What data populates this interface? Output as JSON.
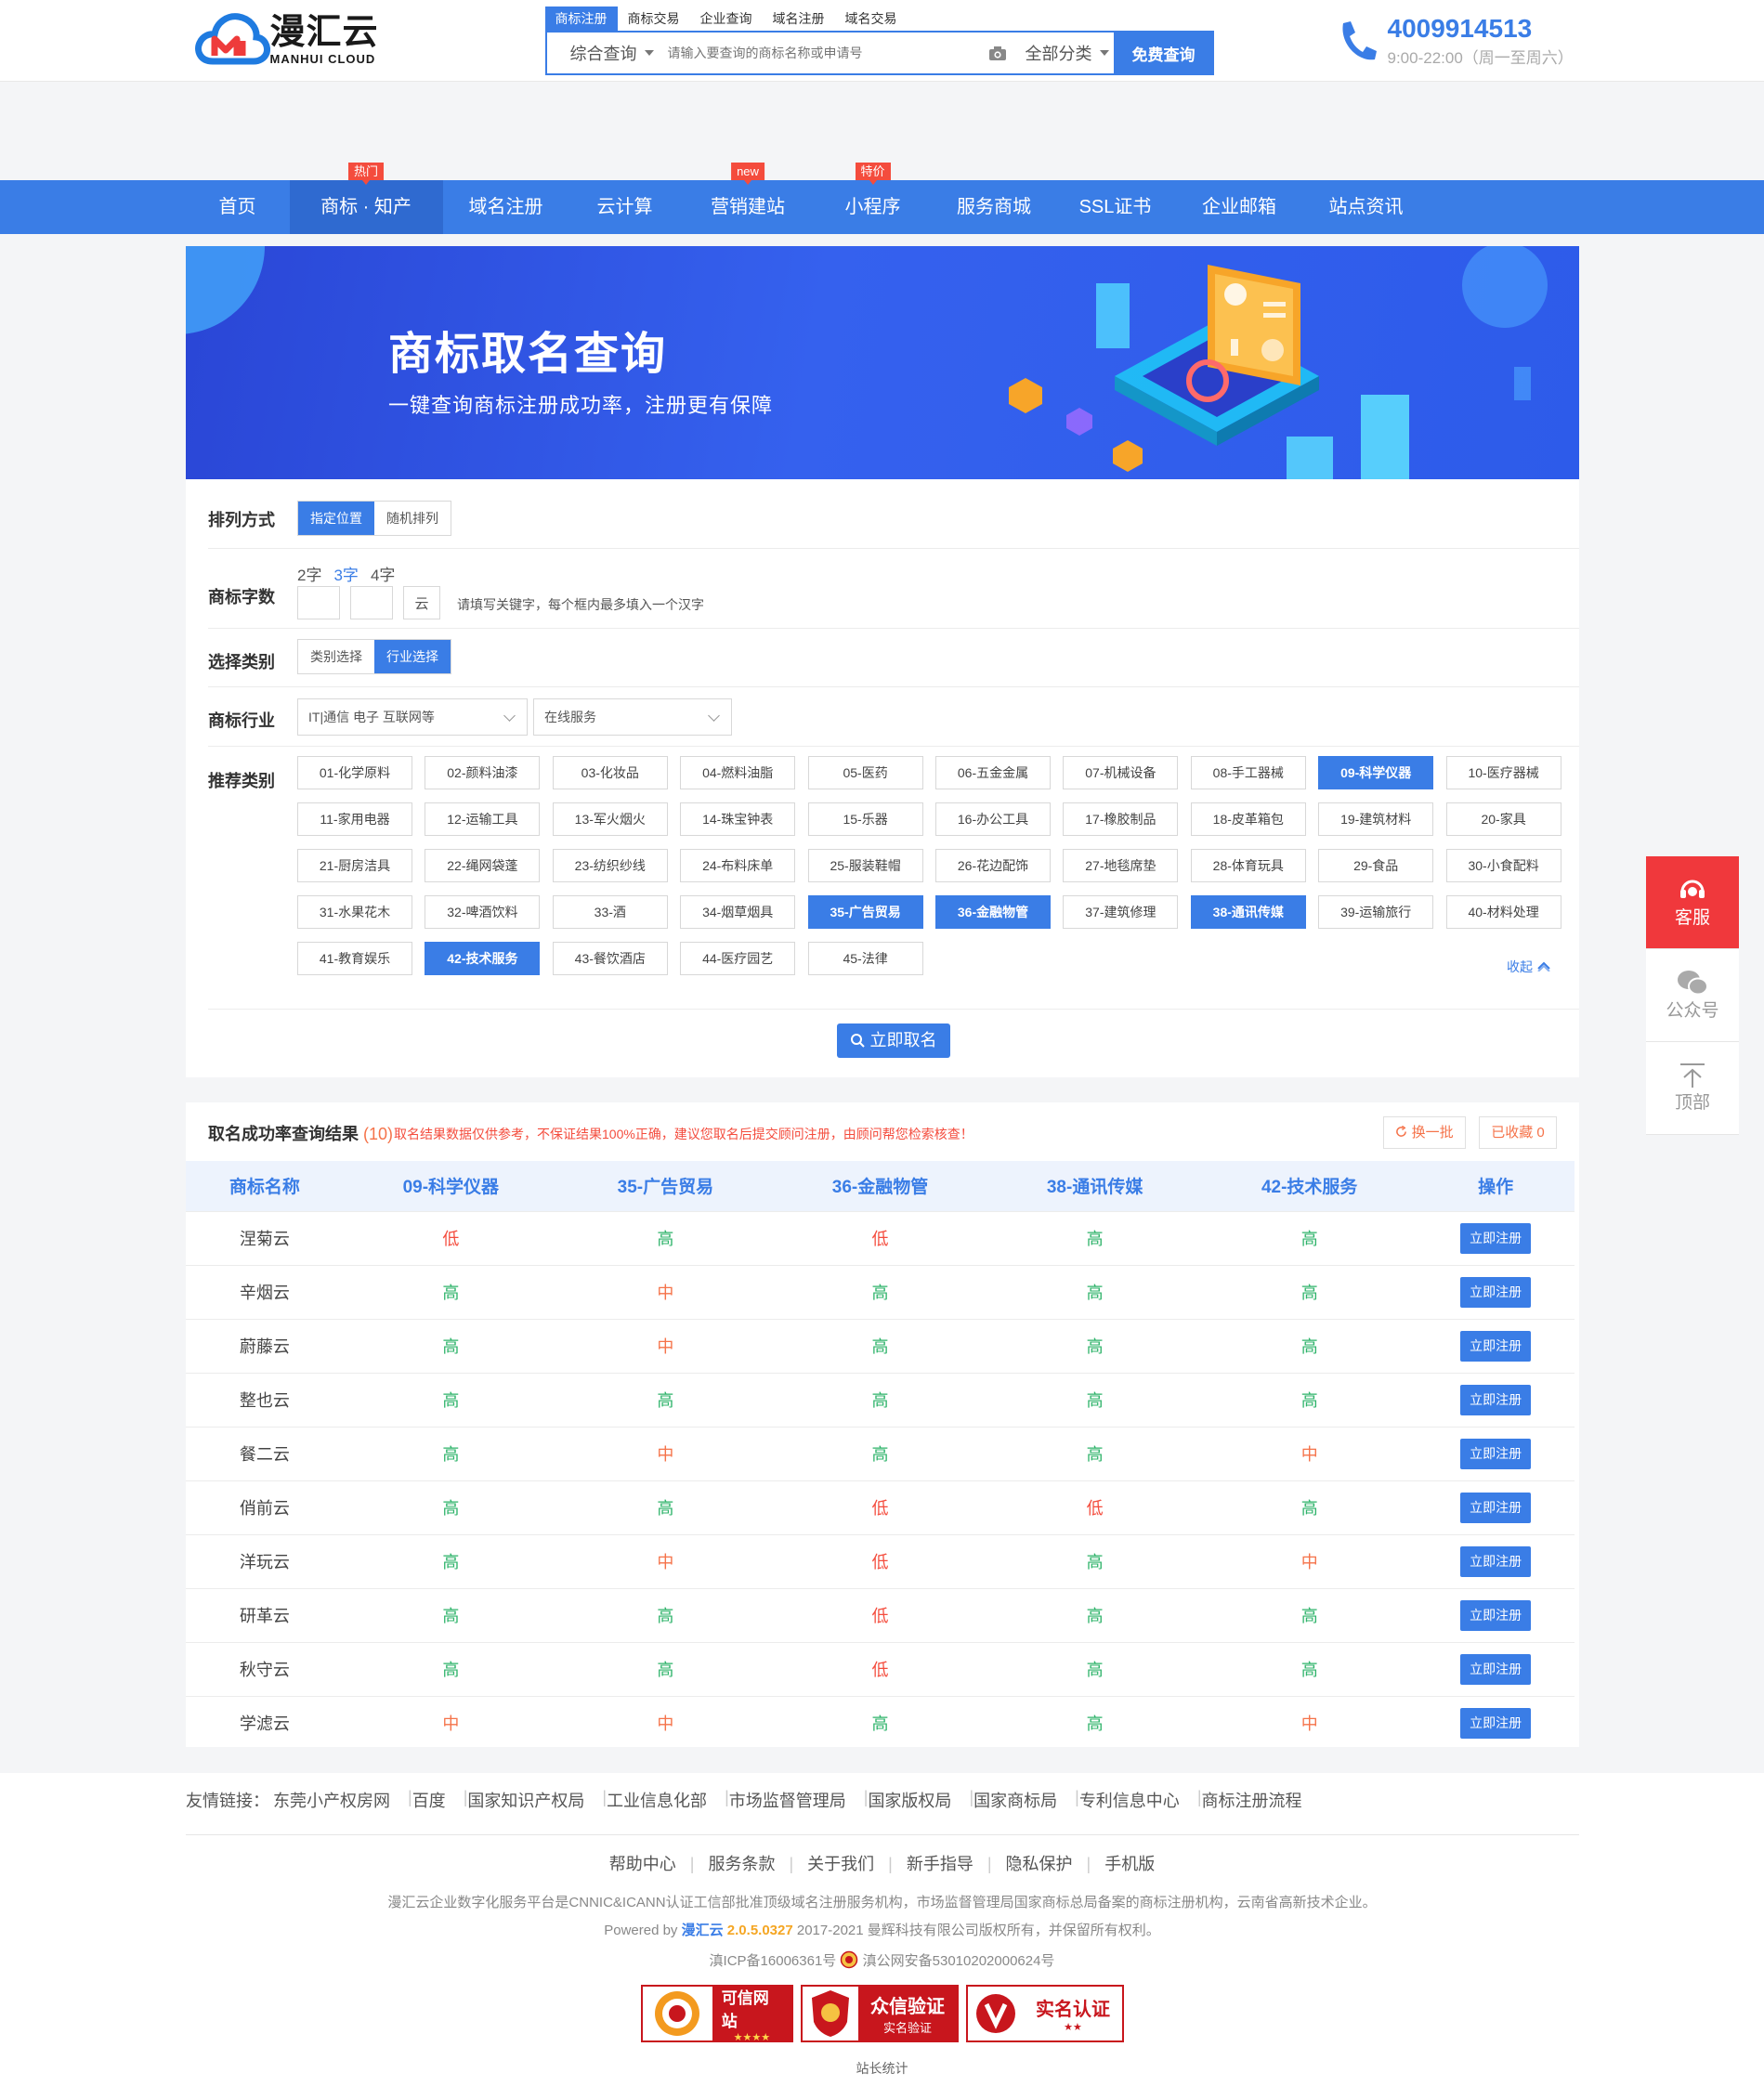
{
  "brand": {
    "name_cn": "漫汇云",
    "name_en": "MANHUI CLOUD"
  },
  "search": {
    "tabs": [
      "商标注册",
      "商标交易",
      "企业查询",
      "域名注册",
      "域名交易"
    ],
    "active_tab": 0,
    "scope": "综合查询",
    "placeholder": "请输入要查询的商标名称或申请号",
    "category": "全部分类",
    "button": "免费查询"
  },
  "contact": {
    "phone": "4009914513",
    "hours": "9:00-22:00（周一至周六）"
  },
  "nav": [
    {
      "label": "首页"
    },
    {
      "label": "商标 · 知产",
      "badge": "热门",
      "active": true
    },
    {
      "label": "域名注册"
    },
    {
      "label": "云计算"
    },
    {
      "label": "营销建站",
      "badge": "new"
    },
    {
      "label": "小程序",
      "badge": "特价"
    },
    {
      "label": "服务商城"
    },
    {
      "label": "SSL证书"
    },
    {
      "label": "企业邮箱"
    },
    {
      "label": "站点资讯"
    }
  ],
  "banner": {
    "title": "商标取名查询",
    "subtitle": "一键查询商标注册成功率，注册更有保障"
  },
  "filters": {
    "sort": {
      "label": "排列方式",
      "options": [
        "指定位置",
        "随机排列"
      ],
      "active": 0
    },
    "length": {
      "label": "商标字数",
      "options": [
        "2字",
        "3字",
        "4字"
      ],
      "active": 1,
      "fixed_char": "云",
      "hint": "请填写关键字，每个框内最多填入一个汉字"
    },
    "select_type": {
      "label": "选择类别",
      "options": [
        "类别选择",
        "行业选择"
      ],
      "active": 1
    },
    "industry": {
      "label": "商标行业",
      "primary": "IT|通信 电子 互联网等",
      "secondary": "在线服务"
    },
    "recommend": {
      "label": "推荐类别",
      "collapse": "收起"
    },
    "submit": "立即取名"
  },
  "categories": [
    {
      "label": "01-化学原料"
    },
    {
      "label": "02-颜料油漆"
    },
    {
      "label": "03-化妆品"
    },
    {
      "label": "04-燃料油脂"
    },
    {
      "label": "05-医药"
    },
    {
      "label": "06-五金金属"
    },
    {
      "label": "07-机械设备"
    },
    {
      "label": "08-手工器械"
    },
    {
      "label": "09-科学仪器",
      "selected": true
    },
    {
      "label": "10-医疗器械"
    },
    {
      "label": "11-家用电器"
    },
    {
      "label": "12-运输工具"
    },
    {
      "label": "13-军火烟火"
    },
    {
      "label": "14-珠宝钟表"
    },
    {
      "label": "15-乐器"
    },
    {
      "label": "16-办公工具"
    },
    {
      "label": "17-橡胶制品"
    },
    {
      "label": "18-皮革箱包"
    },
    {
      "label": "19-建筑材料"
    },
    {
      "label": "20-家具"
    },
    {
      "label": "21-厨房洁具"
    },
    {
      "label": "22-绳网袋蓬"
    },
    {
      "label": "23-纺织纱线"
    },
    {
      "label": "24-布料床单"
    },
    {
      "label": "25-服装鞋帽"
    },
    {
      "label": "26-花边配饰"
    },
    {
      "label": "27-地毯席垫"
    },
    {
      "label": "28-体育玩具"
    },
    {
      "label": "29-食品"
    },
    {
      "label": "30-小食配料"
    },
    {
      "label": "31-水果花木"
    },
    {
      "label": "32-啤酒饮料"
    },
    {
      "label": "33-酒"
    },
    {
      "label": "34-烟草烟具"
    },
    {
      "label": "35-广告贸易",
      "selected": true
    },
    {
      "label": "36-金融物管",
      "selected": true
    },
    {
      "label": "37-建筑修理"
    },
    {
      "label": "38-通讯传媒",
      "selected": true
    },
    {
      "label": "39-运输旅行"
    },
    {
      "label": "40-材料处理"
    },
    {
      "label": "41-教育娱乐"
    },
    {
      "label": "42-技术服务",
      "selected": true
    },
    {
      "label": "43-餐饮酒店"
    },
    {
      "label": "44-医疗园艺"
    },
    {
      "label": "45-法律"
    }
  ],
  "results": {
    "title": "取名成功率查询结果",
    "count": "(10)",
    "note": "取名结果数据仅供参考，不保证结果100%正确，建议您取名后提交顾问注册，由顾问帮您检索核查！",
    "refresh": "换一批",
    "saved": "已收藏 0",
    "columns": [
      "商标名称",
      "09-科学仪器",
      "35-广告贸易",
      "36-金融物管",
      "38-通讯传媒",
      "42-技术服务",
      "操作"
    ],
    "action": "立即注册",
    "rows": [
      {
        "name": "涅菊云",
        "r": [
          "低",
          "高",
          "低",
          "高",
          "高"
        ]
      },
      {
        "name": "辛烟云",
        "r": [
          "高",
          "中",
          "高",
          "高",
          "高"
        ]
      },
      {
        "name": "蔚藤云",
        "r": [
          "高",
          "中",
          "高",
          "高",
          "高"
        ]
      },
      {
        "name": "整也云",
        "r": [
          "高",
          "高",
          "高",
          "高",
          "高"
        ]
      },
      {
        "name": "餐二云",
        "r": [
          "高",
          "中",
          "高",
          "高",
          "中"
        ]
      },
      {
        "name": "俏前云",
        "r": [
          "高",
          "高",
          "低",
          "低",
          "高"
        ]
      },
      {
        "name": "洋玩云",
        "r": [
          "高",
          "中",
          "低",
          "高",
          "中"
        ]
      },
      {
        "name": "研革云",
        "r": [
          "高",
          "高",
          "低",
          "高",
          "高"
        ]
      },
      {
        "name": "秋守云",
        "r": [
          "高",
          "高",
          "低",
          "高",
          "高"
        ]
      },
      {
        "name": "学滤云",
        "r": [
          "中",
          "中",
          "高",
          "高",
          "中"
        ]
      }
    ]
  },
  "colors": {
    "primary": "#3a7de6",
    "high": "#2eb36a",
    "medium": "#f5734a",
    "low": "#f44c3d"
  },
  "footer": {
    "links_label": "友情链接：",
    "links": [
      "东莞小产权房网",
      "百度",
      "国家知识产权局",
      "工业信息化部",
      "市场监督管理局",
      "国家版权局",
      "国家商标局",
      "专利信息中心",
      "商标注册流程"
    ],
    "help": [
      "帮助中心",
      "服务条款",
      "关于我们",
      "新手指导",
      "隐私保护",
      "手机版"
    ],
    "desc": "漫汇云企业数字化服务平台是CNNIC&ICANN认证工信部批准顶级域名注册服务机构，市场监督管理局国家商标总局备案的商标注册机构，云南省高新技术企业。",
    "powered_prefix": "Powered by ",
    "powered_brand": "漫汇云",
    "version": "2.0.5.0327",
    "copyright": "2017-2021 曼辉科技有限公司版权所有，并保留所有权利。",
    "icp": "滇ICP备16006361号",
    "police": "滇公网安备53010202000624号",
    "badges": [
      {
        "title": "可信网站",
        "sub": "★★★★"
      },
      {
        "title": "众信验证",
        "sub": "实名验证"
      },
      {
        "title": "实名认证",
        "sub": "★★"
      }
    ],
    "stats": "站长统计"
  },
  "side": {
    "service": "客服",
    "wechat": "公众号",
    "top": "顶部"
  }
}
